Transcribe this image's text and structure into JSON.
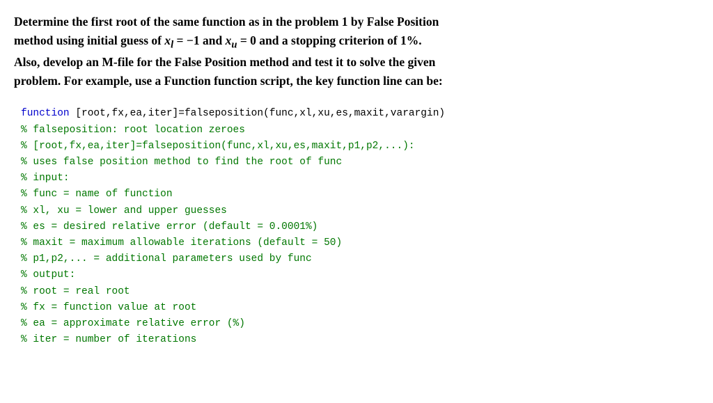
{
  "problem": {
    "statement_parts": [
      "Determine the first root of the same function as in the problem 1 by False Position",
      "method using initial guess of ",
      "x",
      "l",
      " = −1 and ",
      "x",
      "u",
      " = 0 and a stopping criterion of 1%.",
      "Also, develop an M-file for the False Position method and test it to solve the given",
      "problem. For example, use a Function function script, the key function line can be:"
    ]
  },
  "code": {
    "lines": [
      {
        "type": "function",
        "text": "function [root,fx,ea,iter]=falseposition(func,xl,xu,es,maxit,varargin)"
      },
      {
        "type": "comment",
        "text": "% falseposition: root location zeroes"
      },
      {
        "type": "comment",
        "text": "% [root,fx,ea,iter]=falseposition(func,xl,xu,es,maxit,p1,p2,...):"
      },
      {
        "type": "comment",
        "text": "% uses false position method to find the root of func"
      },
      {
        "type": "comment",
        "text": "% input:"
      },
      {
        "type": "comment",
        "text": "% func = name of function"
      },
      {
        "type": "comment",
        "text": "% xl, xu = lower and upper guesses"
      },
      {
        "type": "comment",
        "text": "% es = desired relative error (default = 0.0001%)"
      },
      {
        "type": "comment",
        "text": "% maxit = maximum allowable iterations (default = 50)"
      },
      {
        "type": "comment",
        "text": "% p1,p2,... = additional parameters used by func"
      },
      {
        "type": "comment",
        "text": "% output:"
      },
      {
        "type": "comment",
        "text": "% root = real root"
      },
      {
        "type": "comment",
        "text": "% fx = function value at root"
      },
      {
        "type": "comment",
        "text": "% ea = approximate relative error (%)"
      },
      {
        "type": "comment",
        "text": "% iter = number of iterations"
      }
    ]
  }
}
